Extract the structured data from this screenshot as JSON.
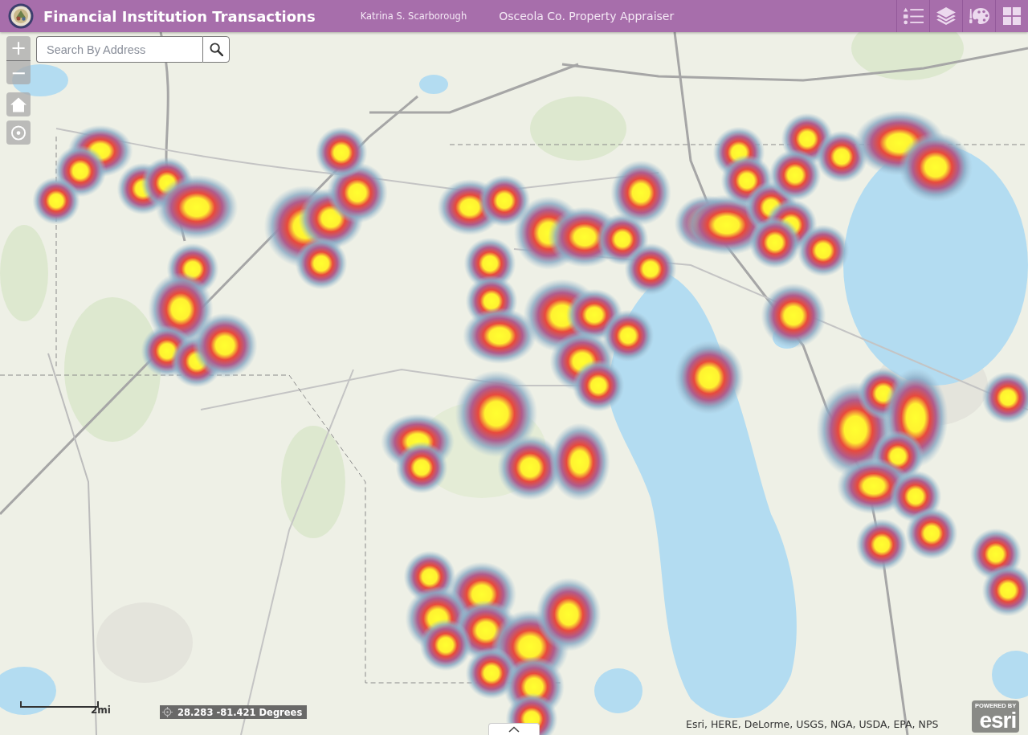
{
  "header": {
    "title": "Financial Institution Transactions",
    "author": "Katrina S. Scarborough",
    "organization": "Osceola Co. Property Appraiser",
    "tools": [
      {
        "kind": "legend"
      },
      {
        "kind": "layers"
      },
      {
        "kind": "basemap"
      },
      {
        "kind": "apps"
      }
    ]
  },
  "map": {
    "zoom_in": "+",
    "zoom_out": "−",
    "search": {
      "placeholder": "Search By Address"
    },
    "scale_label": "2mi",
    "coordinates": "28.283 -81.421 Degrees",
    "attribution": "Esri, HERE, DeLorme, USGS, NGA, USDA, EPA, NPS",
    "logo": {
      "caption": "POWERED BY",
      "wordmark": "esri"
    }
  }
}
